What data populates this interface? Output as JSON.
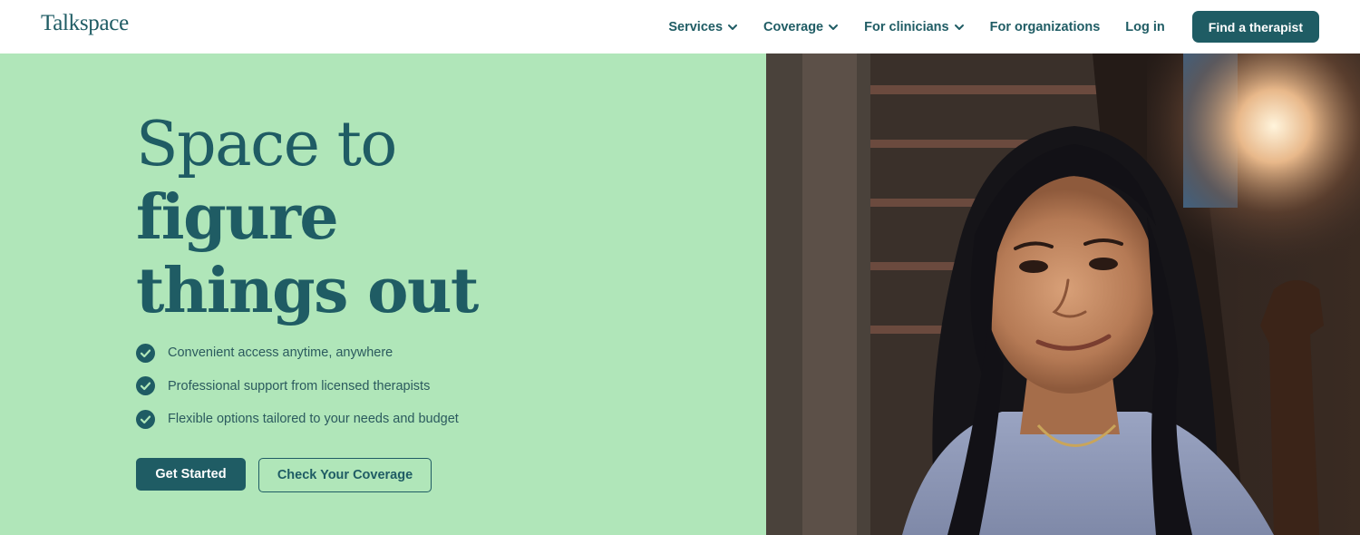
{
  "header": {
    "logo": "Talkspace",
    "nav": [
      {
        "label": "Services",
        "has_dropdown": true
      },
      {
        "label": "Coverage",
        "has_dropdown": true
      },
      {
        "label": "For clinicians",
        "has_dropdown": true
      },
      {
        "label": "For organizations",
        "has_dropdown": false
      },
      {
        "label": "Log in",
        "has_dropdown": false
      }
    ],
    "cta": "Find a therapist"
  },
  "hero": {
    "headline": [
      "Space to",
      "figure",
      "things out"
    ],
    "benefits": [
      "Convenient access anytime, anywhere",
      "Professional support from licensed therapists",
      "Flexible options tailored to your needs and budget"
    ],
    "primary_cta": "Get Started",
    "secondary_cta": "Check Your Coverage",
    "photo_icon": "woman-smiling-photo"
  },
  "colors": {
    "brand": "#1f5c64",
    "hero_bg": "#b0e6b9",
    "header_bg": "#ffffff"
  }
}
